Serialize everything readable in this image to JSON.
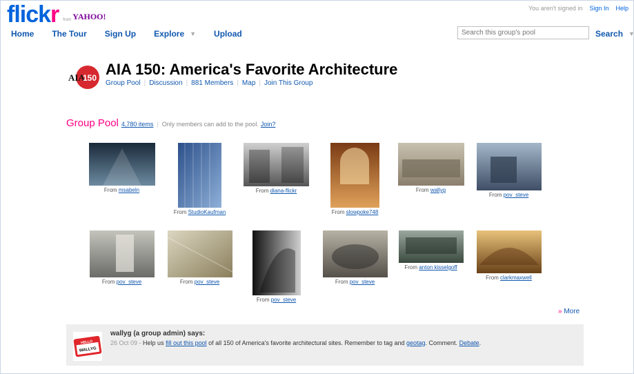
{
  "header": {
    "logo_text": "flick",
    "logo_r": "r",
    "logo_from": "from",
    "logo_yahoo": "YAHOO!",
    "signed_status": "You aren't signed in",
    "sign_in": "Sign In",
    "help": "Help"
  },
  "nav": {
    "home": "Home",
    "tour": "The Tour",
    "signup": "Sign Up",
    "explore": "Explore",
    "upload": "Upload"
  },
  "search": {
    "placeholder": "Search this group's pool",
    "button": "Search"
  },
  "group": {
    "logo_text": "AIA150",
    "title": "AIA 150: America's Favorite Architecture",
    "links": [
      "Group Pool",
      "Discussion",
      "881 Members",
      "Map",
      "Join This Group"
    ]
  },
  "pool": {
    "title": "Group Pool",
    "count": "4,780 items",
    "note": "Only members can add to the pool.",
    "join": "Join?",
    "from_label": "From",
    "thumbs": [
      {
        "author": "msabeln",
        "colors": [
          "#1a2a3a",
          "#6c8aa0"
        ]
      },
      {
        "author": "StudioKaufman",
        "colors": [
          "#2b4f8a",
          "#8fb0d8"
        ]
      },
      {
        "author": "diana-flickr",
        "colors": [
          "#555555",
          "#d0d0d0"
        ]
      },
      {
        "author": "slowpoke748",
        "colors": [
          "#7a3b14",
          "#e0a15a"
        ]
      },
      {
        "author": "wallyg",
        "colors": [
          "#8b7f6c",
          "#c8c1b0"
        ]
      },
      {
        "author": "pov_steve",
        "colors": [
          "#3f4e66",
          "#a4b7c9"
        ]
      },
      {
        "author": "pov_steve",
        "colors": [
          "#6b6b68",
          "#c4c4bd"
        ]
      },
      {
        "author": "pov_steve",
        "colors": [
          "#8a7f5c",
          "#dcd6c0"
        ]
      },
      {
        "author": "pov_steve",
        "colors": [
          "#111111",
          "#cfcfcf"
        ]
      },
      {
        "author": "pov_steve",
        "colors": [
          "#555049",
          "#b7b2a5"
        ]
      },
      {
        "author": "anton kisselgoff",
        "colors": [
          "#3b4a3e",
          "#9aa7a0"
        ]
      },
      {
        "author": "clarkmaxwell",
        "colors": [
          "#6a4219",
          "#e8c27a"
        ]
      }
    ],
    "more": "More"
  },
  "admin_note": {
    "avatar_text_top": "HELLO",
    "avatar_text_name": "WALLYG",
    "who": "wallyg (a group admin) says:",
    "date": "26 Oct 09 -",
    "text_1": "Help us",
    "link_1": "fill out this pool",
    "text_2": "of all 150 of America's favorite architectural sites. Remember to tag and",
    "link_2": "geotag",
    "text_3": ". Comment.",
    "link_3": "Debate",
    "text_4": "."
  },
  "colors": {
    "flickr_blue": "#0063dc",
    "flickr_pink": "#ff0084",
    "link_blue": "#1057ae"
  }
}
